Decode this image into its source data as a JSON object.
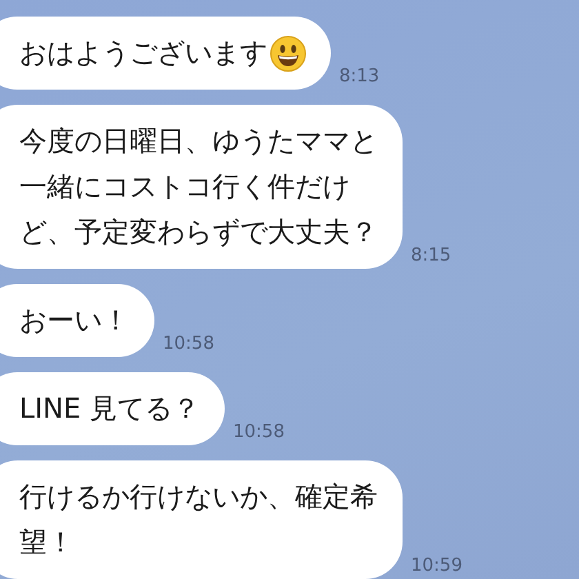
{
  "messages": [
    {
      "kind": "emoji_end",
      "lines": [
        "おはようございます"
      ],
      "time": "8:13"
    },
    {
      "kind": "text",
      "lines": [
        "今度の日曜日、ゆうたママと",
        "一緒にコストコ行く件だけ",
        "ど、予定変わらずで大丈夫？"
      ],
      "time": "8:15"
    },
    {
      "kind": "text",
      "lines": [
        "おーい！"
      ],
      "time": "10:58"
    },
    {
      "kind": "text",
      "lines": [
        "LINE 見てる？"
      ],
      "time": "10:58"
    },
    {
      "kind": "text",
      "lines": [
        "行けるか行けないか、確定希",
        "望！"
      ],
      "time": "10:59"
    }
  ]
}
